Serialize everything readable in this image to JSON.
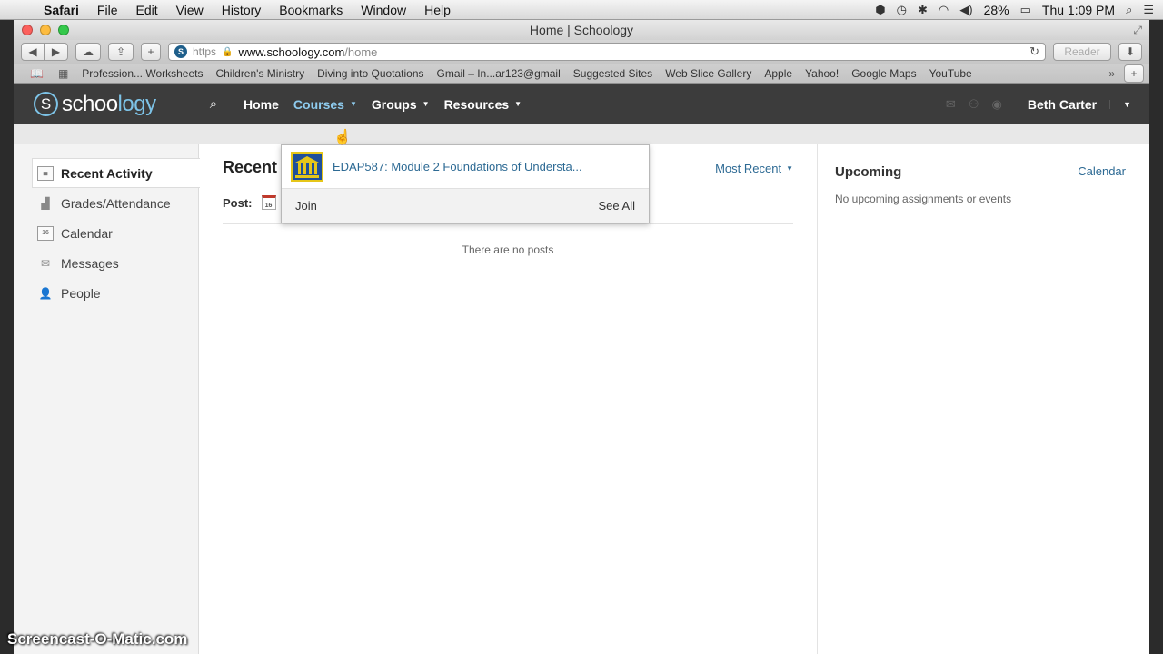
{
  "menubar": {
    "app": "Safari",
    "items": [
      "File",
      "Edit",
      "View",
      "History",
      "Bookmarks",
      "Window",
      "Help"
    ],
    "battery": "28%",
    "clock": "Thu 1:09 PM"
  },
  "window": {
    "title": "Home | Schoology"
  },
  "toolbar": {
    "protocol": "https",
    "domain": "www.schoology.com",
    "path": "/home",
    "reader_label": "Reader"
  },
  "bookmarks": [
    "Profession... Worksheets",
    "Children's Ministry",
    "Diving into Quotations",
    "Gmail – In...ar123@gmail",
    "Suggested Sites",
    "Web Slice Gallery",
    "Apple",
    "Yahoo!",
    "Google Maps",
    "YouTube"
  ],
  "header": {
    "logo_main": "schoo",
    "logo_accent": "logy",
    "nav": [
      "Home",
      "Courses",
      "Groups",
      "Resources"
    ],
    "user": "Beth Carter"
  },
  "sidebar": {
    "items": [
      "Recent Activity",
      "Grades/Attendance",
      "Calendar",
      "Messages",
      "People"
    ]
  },
  "main": {
    "title": "Recent",
    "sort_label": "Most Recent",
    "post_label": "Post:",
    "empty_message": "There are no posts"
  },
  "upcoming": {
    "title": "Upcoming",
    "calendar_link": "Calendar",
    "empty_message": "No upcoming assignments or events"
  },
  "courses_dropdown": {
    "course": "EDAP587: Module 2 Foundations of Understa...",
    "join_label": "Join",
    "see_all_label": "See All"
  },
  "watermark": "Screencast-O-Matic.com",
  "colors": {
    "header_bg": "#3c3c3c",
    "link": "#2d6a94",
    "active_nav": "#8ecbee"
  }
}
